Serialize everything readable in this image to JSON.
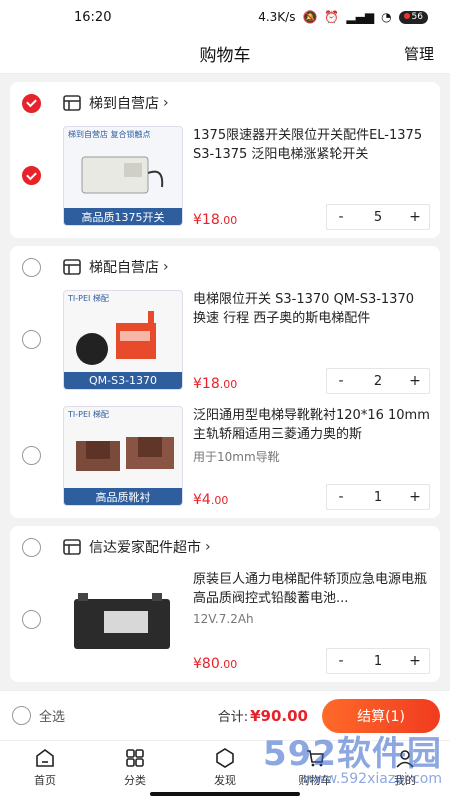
{
  "status": {
    "time": "16:20",
    "speed": "4.3K/s",
    "battery": "56"
  },
  "nav": {
    "title": "购物车",
    "manage": "管理"
  },
  "stores": [
    {
      "name": "梯到自营店",
      "checked": true,
      "items": [
        {
          "title": "1375限速器开关限位开关配件EL-1375 S3-1375 泛阳电梯涨紧轮开关",
          "spec": "",
          "price_symbol": "¥",
          "price_int": "18",
          "price_dec": ".00",
          "qty": "5",
          "checked": true,
          "thumb_caption": "高品质1375开关",
          "thumb_top": "梯到自营店   复合锁触点",
          "thumb_color": "#ffffff"
        }
      ]
    },
    {
      "name": "梯配自营店",
      "checked": false,
      "items": [
        {
          "title": "电梯限位开关 S3-1370 QM-S3-1370 换速 行程 西子奥的斯电梯配件",
          "spec": "",
          "price_symbol": "¥",
          "price_int": "18",
          "price_dec": ".00",
          "qty": "2",
          "checked": false,
          "thumb_caption": "QM-S3-1370",
          "thumb_top": "TI-PEI 梯配",
          "thumb_color": "#ffffff"
        },
        {
          "title": "泛阳通用型电梯导靴靴衬120*16 10mm主轨轿厢适用三菱通力奥的斯",
          "spec": "用于10mm导靴",
          "price_symbol": "¥",
          "price_int": "4",
          "price_dec": ".00",
          "qty": "1",
          "checked": false,
          "thumb_caption": "高品质靴衬",
          "thumb_top": "TI-PEI 梯配",
          "thumb_color": "#ffffff"
        }
      ]
    },
    {
      "name": "信达爱家配件超市",
      "checked": false,
      "items": [
        {
          "title": "原装巨人通力电梯配件轿顶应急电源电瓶 高品质阀控式铅酸蓄电池...",
          "spec": "12V.7.2Ah",
          "price_symbol": "¥",
          "price_int": "80",
          "price_dec": ".00",
          "qty": "1",
          "checked": false,
          "thumb_caption": "",
          "thumb_top": "",
          "thumb_color": "#ffffff"
        }
      ]
    }
  ],
  "footer": {
    "select_all": "全选",
    "total_label": "合计:",
    "total_value": "¥90.00",
    "checkout": "结算(1)"
  },
  "tabs": [
    {
      "label": "首页",
      "icon": "home-icon"
    },
    {
      "label": "分类",
      "icon": "grid-icon"
    },
    {
      "label": "发现",
      "icon": "compass-icon"
    },
    {
      "label": "购物车",
      "icon": "cart-icon"
    },
    {
      "label": "我的",
      "icon": "user-icon"
    }
  ],
  "watermark": {
    "big": "592软件园",
    "small": "www.592xiazai.com"
  },
  "colors": {
    "accent": "#e8222a",
    "checkout_start": "#ff6a2a",
    "checkout_end": "#f03b1f",
    "thumb_band": "#2f5e9e"
  }
}
